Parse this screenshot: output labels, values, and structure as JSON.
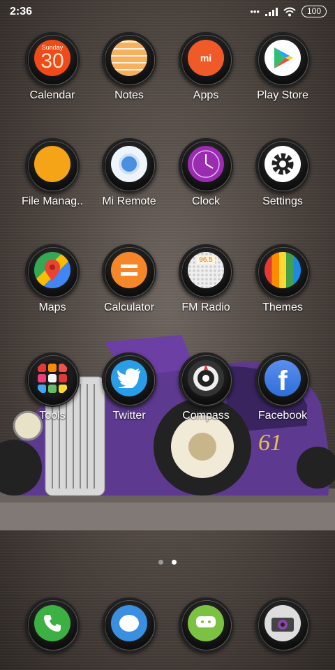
{
  "status": {
    "time": "2:36",
    "battery": "100"
  },
  "apps": [
    {
      "label": "Calendar",
      "calendar_day": "Sunday",
      "calendar_date": "30"
    },
    {
      "label": "Notes"
    },
    {
      "label": "Apps"
    },
    {
      "label": "Play Store"
    },
    {
      "label": "File Manag.."
    },
    {
      "label": "Mi Remote"
    },
    {
      "label": "Clock"
    },
    {
      "label": "Settings"
    },
    {
      "label": "Maps"
    },
    {
      "label": "Calculator"
    },
    {
      "label": "FM Radio",
      "radio_display": "96.5"
    },
    {
      "label": "Themes"
    },
    {
      "label": "Tools"
    },
    {
      "label": "Twitter"
    },
    {
      "label": "Compass"
    },
    {
      "label": "Facebook"
    }
  ],
  "dock": [
    {
      "name": "phone"
    },
    {
      "name": "messages"
    },
    {
      "name": "chat"
    },
    {
      "name": "camera"
    }
  ],
  "wallpaper": {
    "car_badge": "61"
  },
  "pages": {
    "count": 2,
    "current": 2
  },
  "colors": {
    "calendar": "#f04a1a",
    "notes": "#f5b060",
    "apps": "#f05a28",
    "file": "#f5a417",
    "clock": "#9b2bb0",
    "calculator": "#f5862a",
    "twitter": "#2a9de8",
    "facebook": "#2e6fd6",
    "phone": "#3cb043",
    "car": "#5a3a8a"
  }
}
